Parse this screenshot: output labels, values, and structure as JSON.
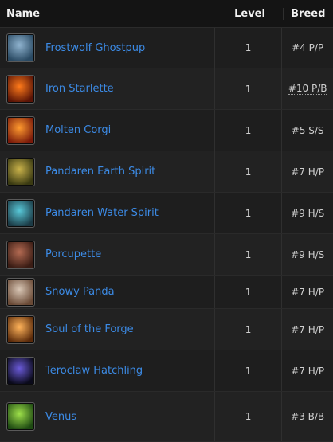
{
  "header": {
    "name": "Name",
    "level": "Level",
    "breed": "Breed"
  },
  "rows": [
    {
      "name": "Frostwolf Ghostpup",
      "level": "1",
      "breed": "#4 P/P",
      "icon": "ghost-wolf-icon",
      "colors": [
        "#8fb3cf",
        "#2a4a63"
      ]
    },
    {
      "name": "Iron Starlette",
      "level": "1",
      "breed": "#10 P/B",
      "icon": "iron-star-icon",
      "colors": [
        "#ff7a1a",
        "#5a1406"
      ]
    },
    {
      "name": "Molten Corgi",
      "level": "1",
      "breed": "#5 S/S",
      "icon": "molten-corgi-icon",
      "colors": [
        "#ff9a2e",
        "#7a1a0a"
      ]
    },
    {
      "name": "Pandaren Earth Spirit",
      "level": "1",
      "breed": "#7 H/P",
      "icon": "earth-spirit-icon",
      "colors": [
        "#c9b24a",
        "#3a3a12"
      ]
    },
    {
      "name": "Pandaren Water Spirit",
      "level": "1",
      "breed": "#9 H/S",
      "icon": "water-spirit-icon",
      "colors": [
        "#58c8d8",
        "#1b3a45"
      ]
    },
    {
      "name": "Porcupette",
      "level": "1",
      "breed": "#9 H/S",
      "icon": "porcupine-icon",
      "colors": [
        "#b36a52",
        "#3a1c14"
      ]
    },
    {
      "name": "Snowy Panda",
      "level": "1",
      "breed": "#7 H/P",
      "icon": "panda-icon",
      "colors": [
        "#d8c6b5",
        "#6a4a36"
      ]
    },
    {
      "name": "Soul of the Forge",
      "level": "1",
      "breed": "#7 H/P",
      "icon": "forge-soul-icon",
      "colors": [
        "#ffb35a",
        "#5a2a0a"
      ]
    },
    {
      "name": "Teroclaw Hatchling",
      "level": "1",
      "breed": "#7 H/P",
      "icon": "claw-icon",
      "colors": [
        "#6a5ad8",
        "#0a0a1a"
      ]
    },
    {
      "name": "Venus",
      "level": "1",
      "breed": "#3 B/B",
      "icon": "venus-plant-icon",
      "colors": [
        "#9ee04a",
        "#1e4a12"
      ]
    }
  ]
}
